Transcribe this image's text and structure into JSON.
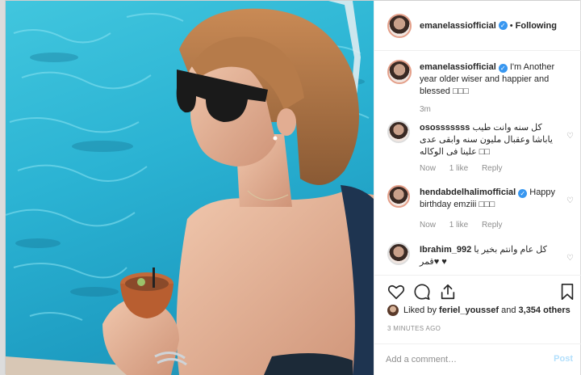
{
  "post": {
    "author": "emanelassiofficial",
    "follow_state": "Following",
    "caption_text": "I'm Another year older wiser and happier and blessed",
    "caption_emoji": "□□□",
    "caption_age": "3m"
  },
  "comments": [
    {
      "username": "ososssssss",
      "text": "كل سنه وانت طيب ياباشا وعقبال مليون سنه وابقى عدى علينا فى الوكاله",
      "emoji": "□□",
      "age": "Now",
      "likes": "1 like",
      "reply": "Reply"
    },
    {
      "username": "hendabdelhalimofficial",
      "text": "Happy birthday emziii",
      "emoji": "□□□",
      "age": "Now",
      "likes": "1 like",
      "reply": "Reply"
    },
    {
      "username": "Ibrahim_992",
      "text": "كل عام وانتم بخير يا قمر",
      "emoji": "♥",
      "emoji2": "♥"
    }
  ],
  "likes": {
    "prefix": "Liked by",
    "user": "feriel_youssef",
    "middle": "and",
    "count": "3,354 others"
  },
  "timestamp": "3 MINUTES AGO",
  "comment_box": {
    "placeholder": "Add a comment…",
    "post_label": "Post"
  },
  "icons": [
    "heart-icon",
    "comment-icon",
    "share-icon",
    "bookmark-icon",
    "verified-badge-icon"
  ],
  "colors": {
    "accent": "#3897f0",
    "post_disabled": "#b2dffc",
    "muted": "#8e8e8e"
  }
}
